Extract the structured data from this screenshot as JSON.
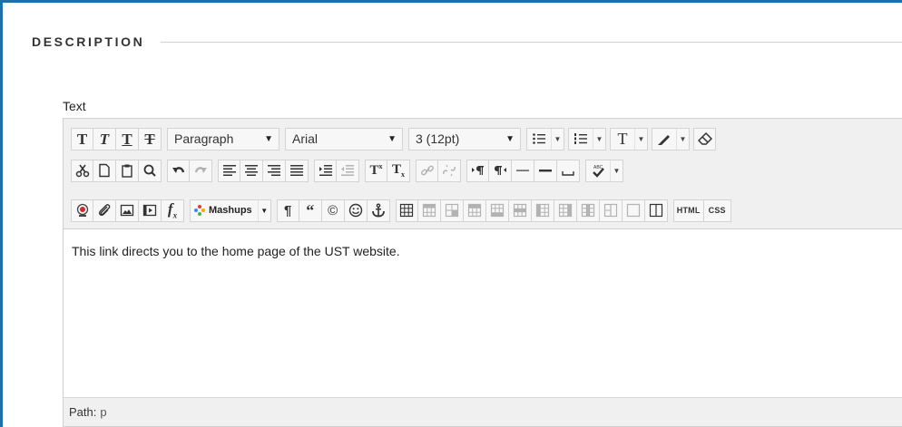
{
  "section": {
    "title": "DESCRIPTION"
  },
  "field": {
    "label": "Text"
  },
  "toolbar": {
    "format_block": "Paragraph",
    "font_family": "Arial",
    "font_size": "3 (12pt)",
    "mashups_label": "Mashups",
    "html_label": "HTML",
    "css_label": "CSS"
  },
  "editor": {
    "content": "This link directs you to the home page of the UST website."
  },
  "status": {
    "path_label": "Path:",
    "path_value": "p"
  },
  "colors": {
    "frame": "#1f6fab",
    "toolbar_bg": "#f0f0f0",
    "border": "#cfcfcf"
  }
}
